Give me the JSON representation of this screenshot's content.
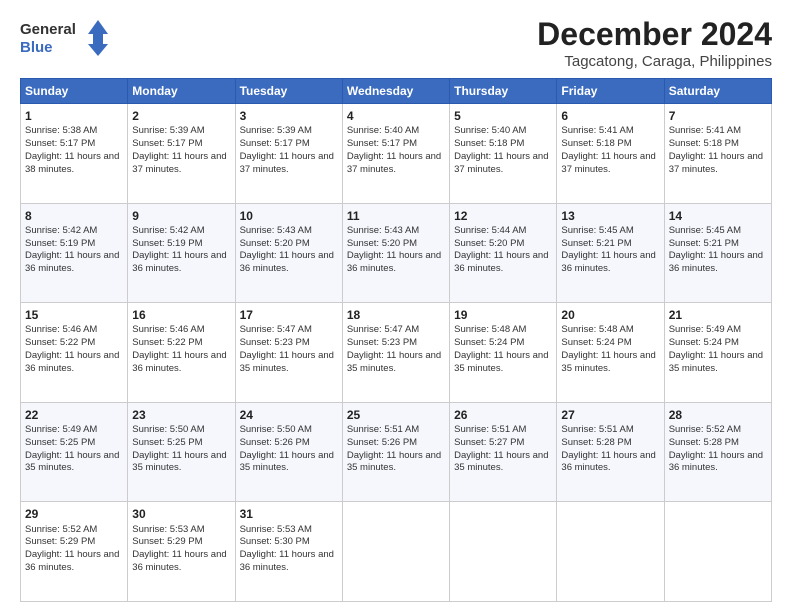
{
  "header": {
    "logo_line1": "General",
    "logo_line2": "Blue",
    "title": "December 2024",
    "subtitle": "Tagcatong, Caraga, Philippines"
  },
  "calendar": {
    "columns": [
      "Sunday",
      "Monday",
      "Tuesday",
      "Wednesday",
      "Thursday",
      "Friday",
      "Saturday"
    ],
    "weeks": [
      [
        {
          "day": "1",
          "sunrise": "Sunrise: 5:38 AM",
          "sunset": "Sunset: 5:17 PM",
          "daylight": "Daylight: 11 hours and 38 minutes."
        },
        {
          "day": "2",
          "sunrise": "Sunrise: 5:39 AM",
          "sunset": "Sunset: 5:17 PM",
          "daylight": "Daylight: 11 hours and 37 minutes."
        },
        {
          "day": "3",
          "sunrise": "Sunrise: 5:39 AM",
          "sunset": "Sunset: 5:17 PM",
          "daylight": "Daylight: 11 hours and 37 minutes."
        },
        {
          "day": "4",
          "sunrise": "Sunrise: 5:40 AM",
          "sunset": "Sunset: 5:17 PM",
          "daylight": "Daylight: 11 hours and 37 minutes."
        },
        {
          "day": "5",
          "sunrise": "Sunrise: 5:40 AM",
          "sunset": "Sunset: 5:18 PM",
          "daylight": "Daylight: 11 hours and 37 minutes."
        },
        {
          "day": "6",
          "sunrise": "Sunrise: 5:41 AM",
          "sunset": "Sunset: 5:18 PM",
          "daylight": "Daylight: 11 hours and 37 minutes."
        },
        {
          "day": "7",
          "sunrise": "Sunrise: 5:41 AM",
          "sunset": "Sunset: 5:18 PM",
          "daylight": "Daylight: 11 hours and 37 minutes."
        }
      ],
      [
        {
          "day": "8",
          "sunrise": "Sunrise: 5:42 AM",
          "sunset": "Sunset: 5:19 PM",
          "daylight": "Daylight: 11 hours and 36 minutes."
        },
        {
          "day": "9",
          "sunrise": "Sunrise: 5:42 AM",
          "sunset": "Sunset: 5:19 PM",
          "daylight": "Daylight: 11 hours and 36 minutes."
        },
        {
          "day": "10",
          "sunrise": "Sunrise: 5:43 AM",
          "sunset": "Sunset: 5:20 PM",
          "daylight": "Daylight: 11 hours and 36 minutes."
        },
        {
          "day": "11",
          "sunrise": "Sunrise: 5:43 AM",
          "sunset": "Sunset: 5:20 PM",
          "daylight": "Daylight: 11 hours and 36 minutes."
        },
        {
          "day": "12",
          "sunrise": "Sunrise: 5:44 AM",
          "sunset": "Sunset: 5:20 PM",
          "daylight": "Daylight: 11 hours and 36 minutes."
        },
        {
          "day": "13",
          "sunrise": "Sunrise: 5:45 AM",
          "sunset": "Sunset: 5:21 PM",
          "daylight": "Daylight: 11 hours and 36 minutes."
        },
        {
          "day": "14",
          "sunrise": "Sunrise: 5:45 AM",
          "sunset": "Sunset: 5:21 PM",
          "daylight": "Daylight: 11 hours and 36 minutes."
        }
      ],
      [
        {
          "day": "15",
          "sunrise": "Sunrise: 5:46 AM",
          "sunset": "Sunset: 5:22 PM",
          "daylight": "Daylight: 11 hours and 36 minutes."
        },
        {
          "day": "16",
          "sunrise": "Sunrise: 5:46 AM",
          "sunset": "Sunset: 5:22 PM",
          "daylight": "Daylight: 11 hours and 36 minutes."
        },
        {
          "day": "17",
          "sunrise": "Sunrise: 5:47 AM",
          "sunset": "Sunset: 5:23 PM",
          "daylight": "Daylight: 11 hours and 35 minutes."
        },
        {
          "day": "18",
          "sunrise": "Sunrise: 5:47 AM",
          "sunset": "Sunset: 5:23 PM",
          "daylight": "Daylight: 11 hours and 35 minutes."
        },
        {
          "day": "19",
          "sunrise": "Sunrise: 5:48 AM",
          "sunset": "Sunset: 5:24 PM",
          "daylight": "Daylight: 11 hours and 35 minutes."
        },
        {
          "day": "20",
          "sunrise": "Sunrise: 5:48 AM",
          "sunset": "Sunset: 5:24 PM",
          "daylight": "Daylight: 11 hours and 35 minutes."
        },
        {
          "day": "21",
          "sunrise": "Sunrise: 5:49 AM",
          "sunset": "Sunset: 5:24 PM",
          "daylight": "Daylight: 11 hours and 35 minutes."
        }
      ],
      [
        {
          "day": "22",
          "sunrise": "Sunrise: 5:49 AM",
          "sunset": "Sunset: 5:25 PM",
          "daylight": "Daylight: 11 hours and 35 minutes."
        },
        {
          "day": "23",
          "sunrise": "Sunrise: 5:50 AM",
          "sunset": "Sunset: 5:25 PM",
          "daylight": "Daylight: 11 hours and 35 minutes."
        },
        {
          "day": "24",
          "sunrise": "Sunrise: 5:50 AM",
          "sunset": "Sunset: 5:26 PM",
          "daylight": "Daylight: 11 hours and 35 minutes."
        },
        {
          "day": "25",
          "sunrise": "Sunrise: 5:51 AM",
          "sunset": "Sunset: 5:26 PM",
          "daylight": "Daylight: 11 hours and 35 minutes."
        },
        {
          "day": "26",
          "sunrise": "Sunrise: 5:51 AM",
          "sunset": "Sunset: 5:27 PM",
          "daylight": "Daylight: 11 hours and 35 minutes."
        },
        {
          "day": "27",
          "sunrise": "Sunrise: 5:51 AM",
          "sunset": "Sunset: 5:28 PM",
          "daylight": "Daylight: 11 hours and 36 minutes."
        },
        {
          "day": "28",
          "sunrise": "Sunrise: 5:52 AM",
          "sunset": "Sunset: 5:28 PM",
          "daylight": "Daylight: 11 hours and 36 minutes."
        }
      ],
      [
        {
          "day": "29",
          "sunrise": "Sunrise: 5:52 AM",
          "sunset": "Sunset: 5:29 PM",
          "daylight": "Daylight: 11 hours and 36 minutes."
        },
        {
          "day": "30",
          "sunrise": "Sunrise: 5:53 AM",
          "sunset": "Sunset: 5:29 PM",
          "daylight": "Daylight: 11 hours and 36 minutes."
        },
        {
          "day": "31",
          "sunrise": "Sunrise: 5:53 AM",
          "sunset": "Sunset: 5:30 PM",
          "daylight": "Daylight: 11 hours and 36 minutes."
        },
        null,
        null,
        null,
        null
      ]
    ]
  }
}
